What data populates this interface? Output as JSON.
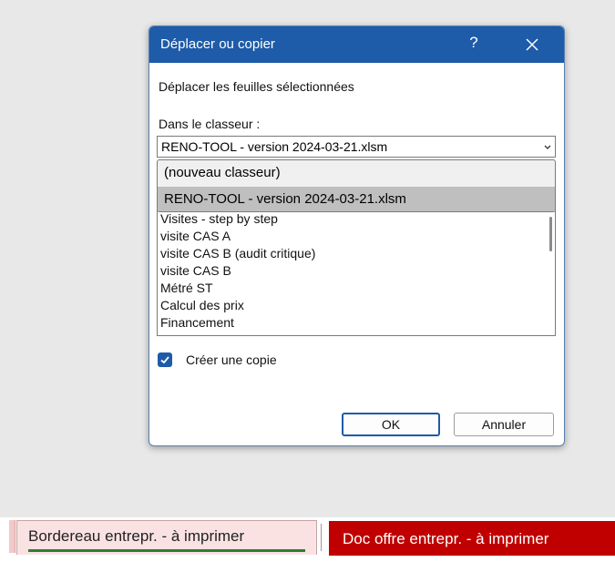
{
  "dialog": {
    "title": "Déplacer ou copier",
    "help": "?",
    "move_label": "Déplacer les feuilles sélectionnées",
    "workbook_label": "Dans le classeur :",
    "workbook_value": "RENO-TOOL - version 2024-03-21.xlsm",
    "dropdown_options": [
      "(nouveau classeur)",
      "RENO-TOOL - version 2024-03-21.xlsm"
    ],
    "sheets": [
      "Visites - step by step",
      "visite CAS A",
      "visite CAS B (audit critique)",
      "visite CAS B",
      "Métré ST",
      "Calcul des prix",
      "Financement"
    ],
    "copy_checkbox_label": "Créer une copie",
    "copy_checked": true,
    "ok_label": "OK",
    "cancel_label": "Annuler",
    "accent": "#1e5ba8"
  },
  "tabs": {
    "active": "Bordereau entrepr. - à imprimer",
    "next": "Doc offre entrepr. - à imprimer",
    "next_color": "#c00000"
  }
}
